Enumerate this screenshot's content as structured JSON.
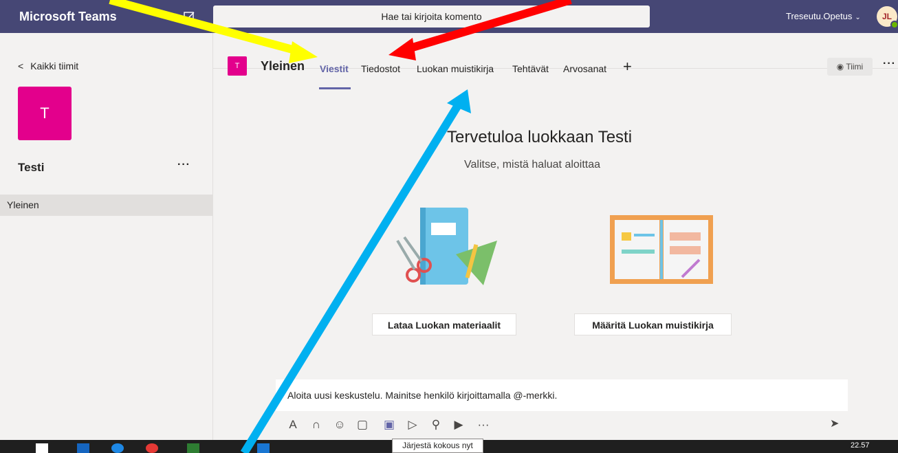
{
  "app": {
    "title": "Microsoft Teams",
    "search_placeholder": "Hae tai kirjoita komento",
    "tenant": "Treseutu.Opetus",
    "user_initials": "JL"
  },
  "sidebar": {
    "back_label": "Kaikki tiimit",
    "team_initial": "T",
    "team_name": "Testi",
    "more": "···",
    "channels": [
      {
        "label": "Yleinen"
      }
    ]
  },
  "channel": {
    "initial": "T",
    "title": "Yleinen",
    "tabs": [
      {
        "label": "Viestit"
      },
      {
        "label": "Tiedostot"
      },
      {
        "label": "Luokan muistikirja"
      },
      {
        "label": "Tehtävät"
      },
      {
        "label": "Arvosanat"
      }
    ],
    "add_tab": "+",
    "team_button": "Tiimi",
    "more": "···"
  },
  "welcome": {
    "title": "Tervetuloa luokkaan Testi",
    "subtitle": "Valitse, mistä haluat aloittaa",
    "button_materials": "Lataa Luokan materiaalit",
    "button_notebook": "Määritä Luokan muistikirja"
  },
  "compose": {
    "placeholder": "Aloita uusi keskustelu. Mainitse henkilö kirjoittamalla @-merkki.",
    "tooltip": "Järjestä kokous nyt"
  },
  "taskbar": {
    "time": "22.57"
  },
  "colors": {
    "header": "#464775",
    "accent": "#6264a7",
    "team": "#e3008c"
  }
}
